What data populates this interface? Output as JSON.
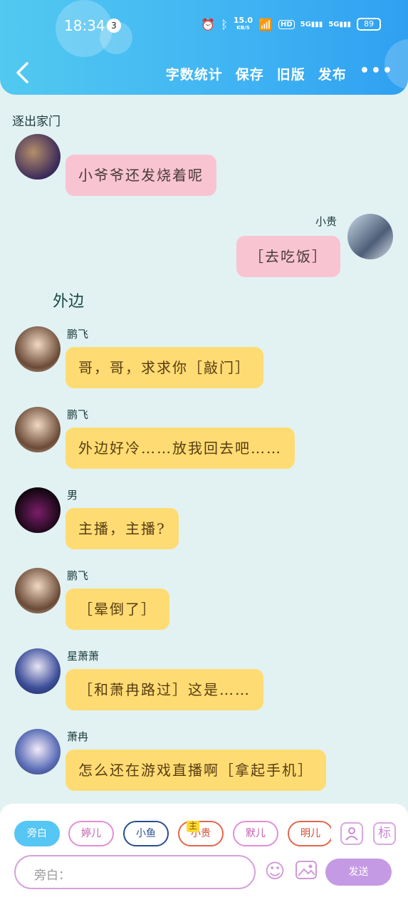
{
  "status_bar": {
    "time": "18:34",
    "notification_count": "3",
    "net_speed": "15.0",
    "net_unit": "KB/S",
    "hd": "HD",
    "sig1": "5G",
    "sig2": "5G",
    "battery": "89"
  },
  "toolbar": {
    "word_count": "字数统计",
    "save": "保存",
    "old_version": "旧版",
    "publish": "发布",
    "more": "•••"
  },
  "scene_title": "逐出家门",
  "narration": "外边",
  "messages": [
    {
      "name": "",
      "text": "小爷爷还发烧着呢",
      "side": "left",
      "color": "pink"
    },
    {
      "name": "小贵",
      "text": "［去吃饭］",
      "side": "right",
      "color": "pink"
    },
    {
      "name": "鹏飞",
      "text": "哥，哥，求求你［敲门］",
      "side": "left",
      "color": "yellow"
    },
    {
      "name": "鹏飞",
      "text": "外边好冷……放我回去吧……",
      "side": "left",
      "color": "yellow"
    },
    {
      "name": "男",
      "text": "主播，主播?",
      "side": "left",
      "color": "yellow"
    },
    {
      "name": "鹏飞",
      "text": "［晕倒了］",
      "side": "left",
      "color": "yellow"
    },
    {
      "name": "星萧萧",
      "text": "［和萧冉路过］这是……",
      "side": "left",
      "color": "yellow"
    },
    {
      "name": "萧冉",
      "text": "怎么还在游戏直播啊［拿起手机］",
      "side": "left",
      "color": "yellow"
    }
  ],
  "composer": {
    "chips": [
      "旁白",
      "婷儿",
      "小鱼",
      "小贵",
      "默儿",
      "明儿"
    ],
    "main_badge": "主",
    "mark_label": "标",
    "input_placeholder": "旁白：",
    "send_label": "发送"
  },
  "colors": {
    "header": "#3fb3f3",
    "bubble_yellow": "#fedc73",
    "bubble_pink": "#f9c4d2",
    "send": "#c59ae4",
    "background": "#e2f2f3"
  }
}
